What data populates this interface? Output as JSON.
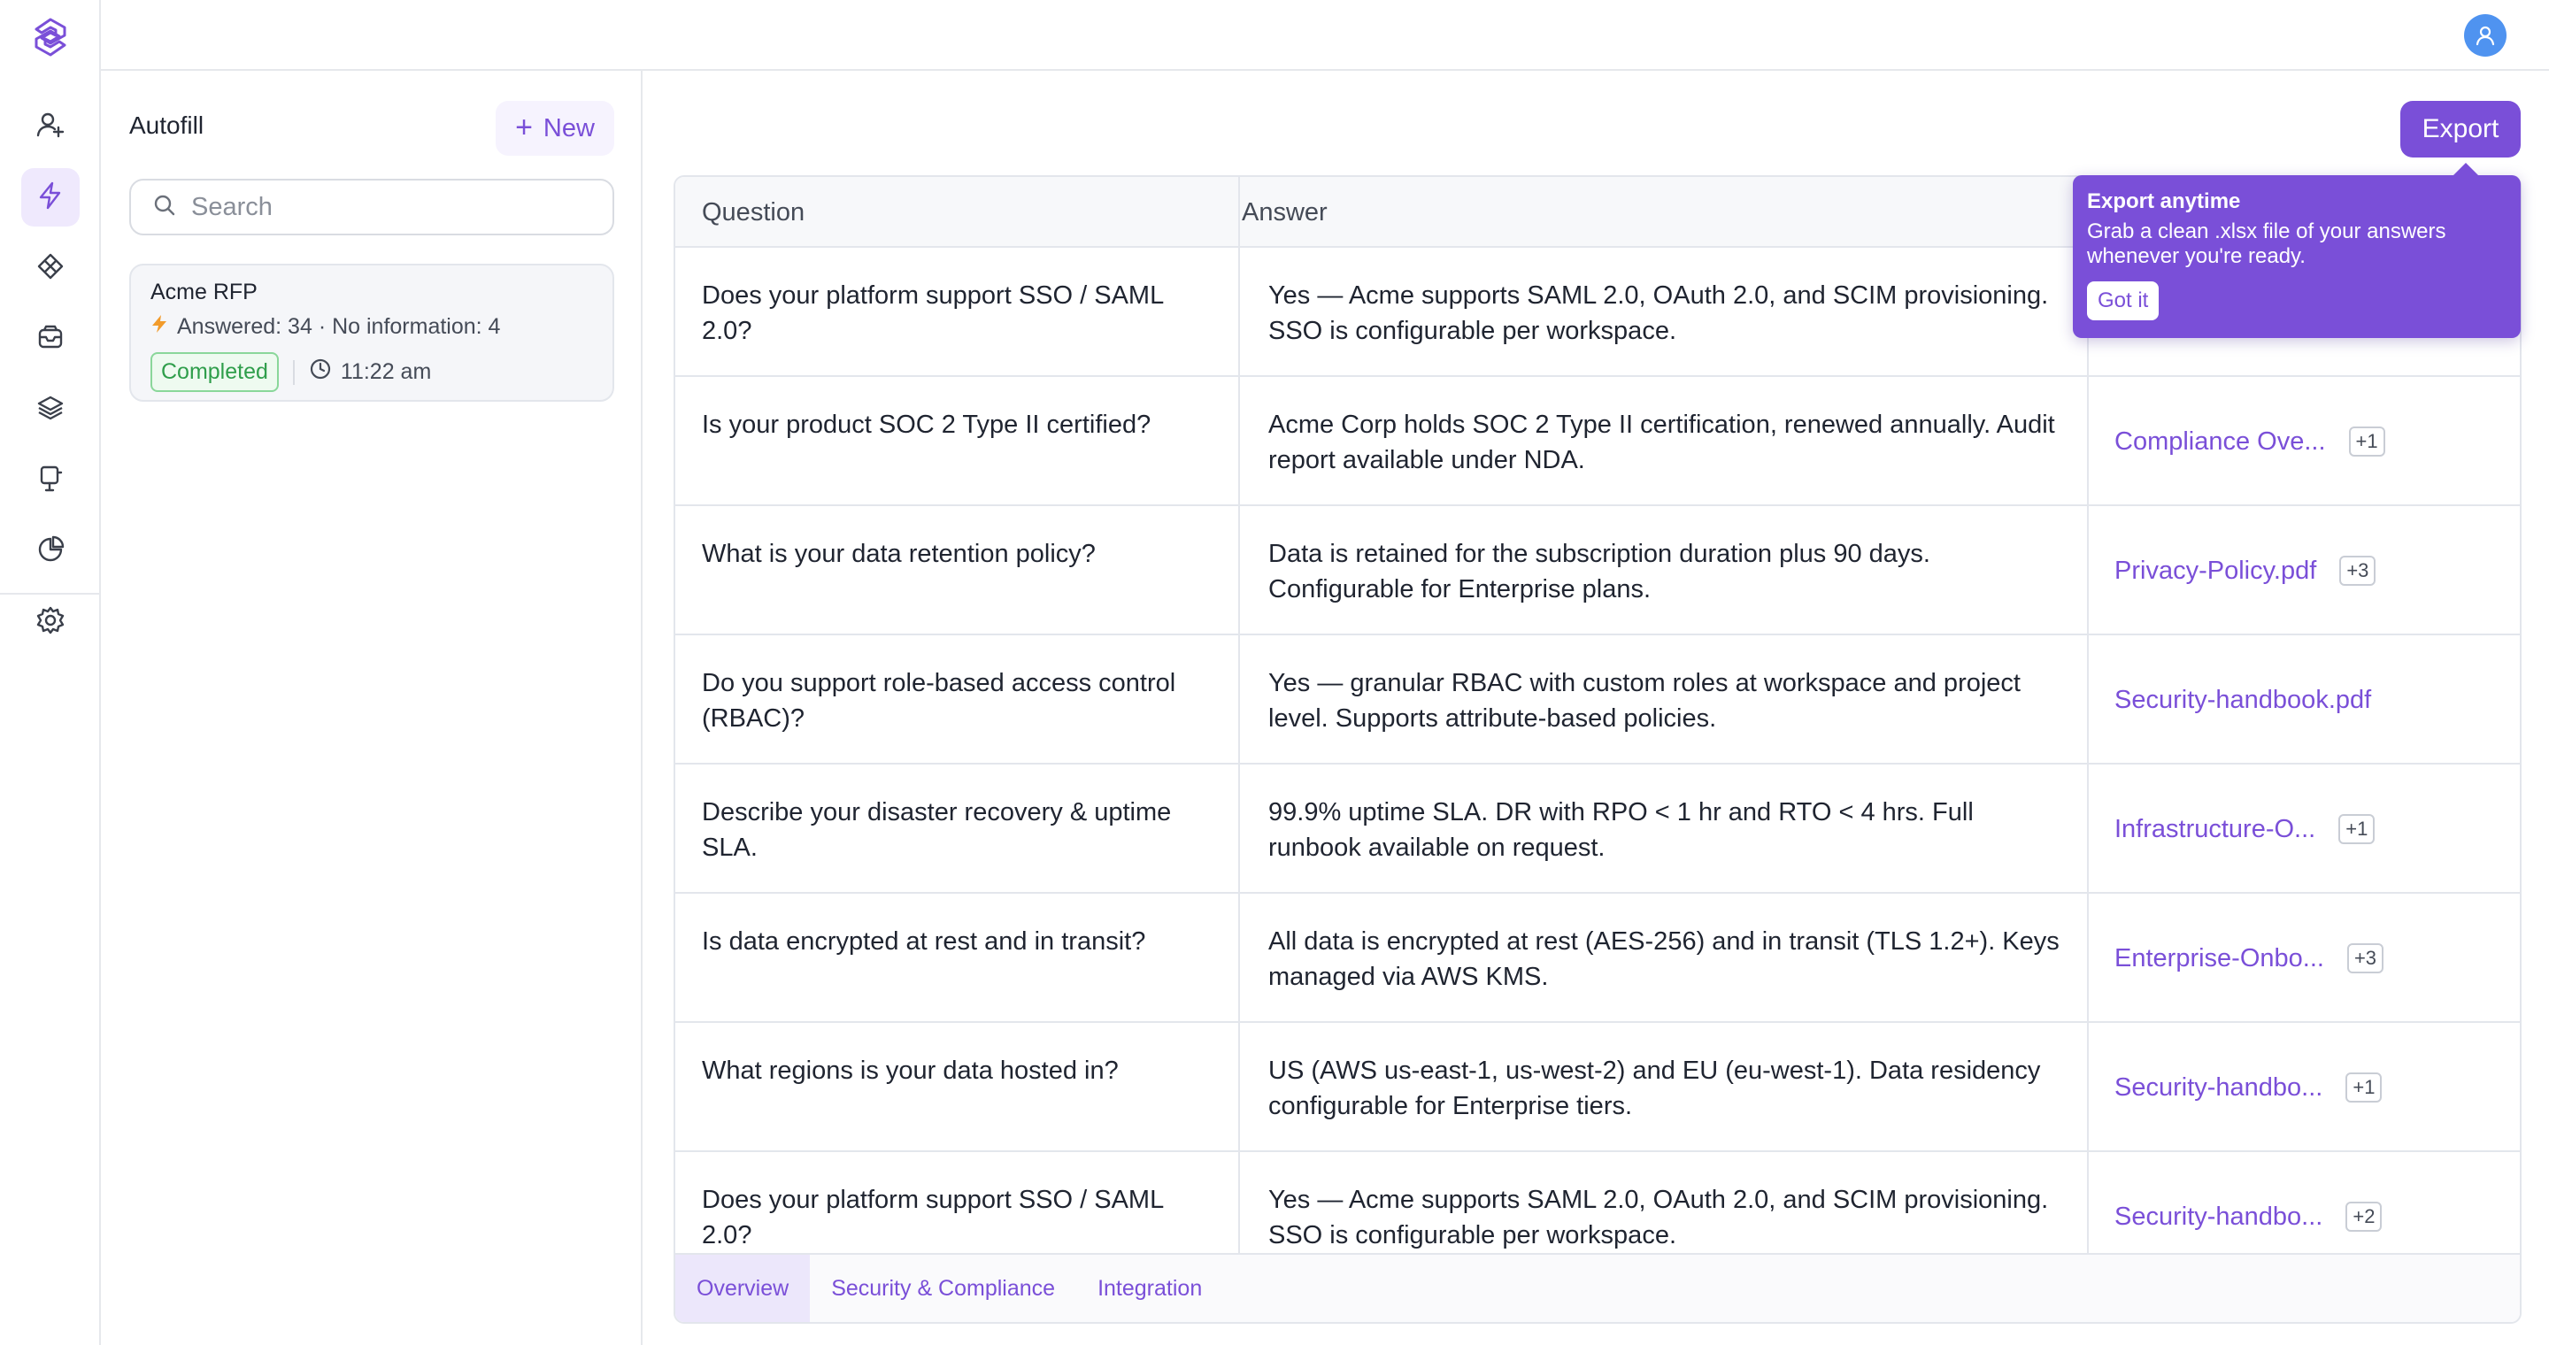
{
  "brand": {
    "accent": "#7a4fd8",
    "logo_icon": "brand-logo-icon"
  },
  "rail": {
    "items": [
      {
        "name": "user-add-icon"
      },
      {
        "name": "bolt-icon",
        "active": true
      },
      {
        "name": "grid-diamond-icon"
      },
      {
        "name": "inbox-icon"
      },
      {
        "name": "layers-icon"
      },
      {
        "name": "presentation-icon"
      },
      {
        "name": "pie-chart-icon"
      },
      {
        "name": "gear-icon"
      }
    ]
  },
  "topbar": {
    "avatar_icon": "user-avatar-icon"
  },
  "panel": {
    "title": "Autofill",
    "new_label": "New",
    "search_placeholder": "Search",
    "card": {
      "title": "Acme RFP",
      "meta": "Answered: 34 · No information: 4",
      "status": "Completed",
      "time": "11:22 am"
    }
  },
  "main": {
    "export_label": "Export",
    "tooltip": {
      "title": "Export anytime",
      "body": "Grab a clean .xlsx file of your answers whenever you're ready.",
      "button": "Got it"
    },
    "columns": {
      "question": "Question",
      "answer": "Answer"
    },
    "rows": [
      {
        "question": "Does your platform support SSO / SAML 2.0?",
        "answer": "Yes — Acme supports SAML 2.0, OAuth 2.0, and SCIM provisioning. SSO is configurable per workspace.",
        "source": "",
        "more": ""
      },
      {
        "question": "Is your product SOC 2 Type II certified?",
        "answer": "Acme Corp holds SOC 2 Type II certification, renewed annually. Audit report available under NDA.",
        "source": "Compliance Ove...",
        "more": "+1"
      },
      {
        "question": "What is your data retention policy?",
        "answer": "Data is retained for the subscription duration plus 90 days. Configurable for Enterprise plans.",
        "source": "Privacy-Policy.pdf",
        "more": "+3"
      },
      {
        "question": "Do you support role-based access control (RBAC)?",
        "answer": "Yes — granular RBAC with custom roles at workspace and project level. Supports attribute-based policies.",
        "source": "Security-handbook.pdf",
        "more": ""
      },
      {
        "question": "Describe your disaster recovery & uptime SLA.",
        "answer": "99.9% uptime SLA. DR with RPO < 1 hr and RTO < 4 hrs. Full runbook available on request.",
        "source": "Infrastructure-O...",
        "more": "+1"
      },
      {
        "question": "Is data encrypted at rest and in transit?",
        "answer": "All data is encrypted at rest (AES-256) and in transit (TLS 1.2+). Keys managed via AWS KMS.",
        "source": "Enterprise-Onbo...",
        "more": "+3"
      },
      {
        "question": "What regions is your data hosted in?",
        "answer": "US (AWS us-east-1, us-west-2) and EU (eu-west-1). Data residency configurable for Enterprise tiers.",
        "source": "Security-handbo...",
        "more": "+1"
      },
      {
        "question": "Does your platform support SSO / SAML 2.0?",
        "answer": "Yes — Acme supports SAML 2.0, OAuth 2.0, and SCIM provisioning. SSO is configurable per workspace.",
        "source": "Security-handbo...",
        "more": "+2"
      }
    ],
    "tabs": [
      {
        "label": "Overview",
        "active": true
      },
      {
        "label": "Security & Compliance"
      },
      {
        "label": "Integration"
      }
    ]
  }
}
